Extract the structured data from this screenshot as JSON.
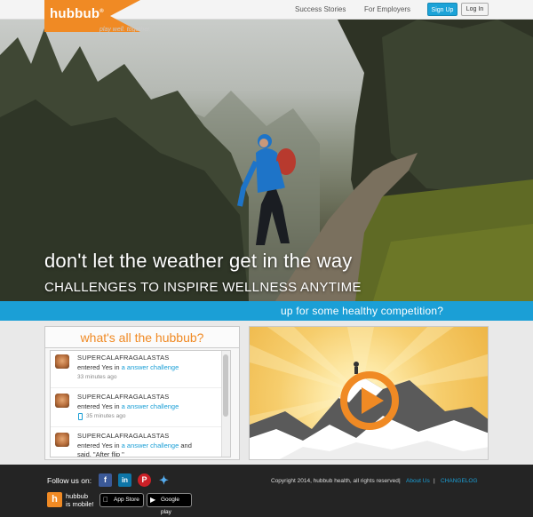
{
  "header": {
    "logo": "hubbub",
    "logo_mark": "®",
    "tagline": "play well. together.",
    "nav": [
      "Success Stories",
      "For Employers"
    ],
    "signup_label": "Sign Up",
    "login_label": "Log In"
  },
  "hero": {
    "title": "don't let the weather get in the way",
    "subtitle": "CHALLENGES TO INSPIRE WELLNESS ANYTIME"
  },
  "band": {
    "text": "up for some healthy competition?"
  },
  "feed": {
    "heading": "what's all the hubbub?",
    "items": [
      {
        "name": "SUPERCALAFRAGALASTAS",
        "action": "entered Yes in",
        "link": "a answer challenge",
        "extra": "",
        "quote": "",
        "time": "33 minutes ago",
        "mobile": false
      },
      {
        "name": "SUPERCALAFRAGALASTAS",
        "action": "entered Yes in",
        "link": "a answer challenge",
        "extra": "",
        "quote": "",
        "time": "35 minutes ago",
        "mobile": true
      },
      {
        "name": "SUPERCALAFRAGALASTAS",
        "action": "entered Yes in",
        "link": "a answer challenge",
        "extra": "and",
        "quote": "said, \"After flip \"",
        "time": "",
        "mobile": false
      }
    ]
  },
  "video": {
    "play_icon": "play-icon",
    "accent": "#f08a24"
  },
  "footer": {
    "follow_label": "Follow us on:",
    "social": [
      "facebook-icon",
      "linkedin-icon",
      "pinterest-icon",
      "twitter-icon"
    ],
    "mobile_line1": "hubbub",
    "mobile_line2": "is mobile!",
    "appstore_label": "App Store",
    "googleplay_label": "Google play",
    "copyright": "Copyright 2014, hubbub health, all rights reserved.",
    "links": [
      "About Us",
      "CHANGELOG"
    ],
    "separator": "|"
  },
  "colors": {
    "brand_orange": "#f08a24",
    "brand_blue": "#1b9fd6"
  }
}
